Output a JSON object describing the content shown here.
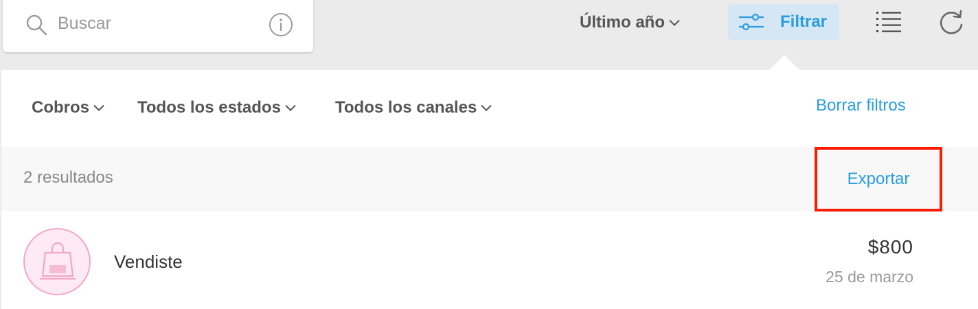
{
  "search": {
    "placeholder": "Buscar",
    "icon": "search-icon",
    "info_icon": "info-icon"
  },
  "toolbar": {
    "period_label": "Último año",
    "filter_label": "Filtrar",
    "filter_icon": "sliders-icon",
    "list_icon": "list-icon",
    "refresh_icon": "refresh-icon"
  },
  "filters": {
    "items": [
      {
        "label": "Cobros"
      },
      {
        "label": "Todos los estados"
      },
      {
        "label": "Todos los canales"
      }
    ],
    "clear_label": "Borrar filtros"
  },
  "results": {
    "count_text": "2 resultados",
    "export_label": "Exportar"
  },
  "transactions": [
    {
      "title": "Vendiste",
      "amount": "$800",
      "date": "25 de marzo",
      "icon": "shopping-bag-icon"
    }
  ],
  "colors": {
    "accent": "#2a9de0",
    "filter_bg": "#d5e6f4",
    "highlight": "#ff1a00",
    "avatar_pink": "#f4a6c6"
  }
}
